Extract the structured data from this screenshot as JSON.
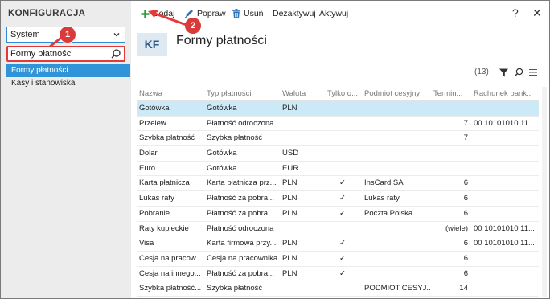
{
  "sidebar": {
    "title": "KONFIGURACJA",
    "select_value": "System",
    "search_value": "Formy płatności",
    "items": [
      {
        "label": "Formy płatności",
        "active": true
      },
      {
        "label": "Kasy i stanowiska",
        "active": false
      }
    ]
  },
  "toolbar": {
    "add": "Dodaj",
    "edit": "Popraw",
    "delete": "Usuń",
    "deactivate": "Dezaktywuj",
    "activate": "Aktywuj",
    "help": "?",
    "close": "✕"
  },
  "header": {
    "tile": "KF",
    "title": "Formy płatności"
  },
  "list_info": {
    "count": "(13)"
  },
  "badges": {
    "first": "1",
    "second": "2"
  },
  "table": {
    "columns": [
      "Nazwa",
      "Typ płatności",
      "Waluta",
      "Tylko o...",
      "Podmiot cesyjny",
      "Termin...",
      "Rachunek bank..."
    ],
    "rows": [
      [
        "Gotówka",
        "Gotówka",
        "PLN",
        "",
        "",
        "",
        ""
      ],
      [
        "Przelew",
        "Płatność odroczona",
        "",
        "",
        "",
        "7",
        "00 10101010 11..."
      ],
      [
        "Szybka płatność",
        "Szybka płatność",
        "",
        "",
        "",
        "7",
        ""
      ],
      [
        "Dolar",
        "Gotówka",
        "USD",
        "",
        "",
        "",
        ""
      ],
      [
        "Euro",
        "Gotówka",
        "EUR",
        "",
        "",
        "",
        ""
      ],
      [
        "Karta płatnicza",
        "Karta płatnicza prz...",
        "PLN",
        "✓",
        "InsCard SA",
        "6",
        ""
      ],
      [
        "Lukas raty",
        "Płatność za pobra...",
        "PLN",
        "✓",
        "Lukas raty",
        "6",
        ""
      ],
      [
        "Pobranie",
        "Płatność za pobra...",
        "PLN",
        "✓",
        "Poczta Polska",
        "6",
        ""
      ],
      [
        "Raty kupieckie",
        "Płatność odroczona",
        "",
        "",
        "",
        "(wiele)",
        "00 10101010 11..."
      ],
      [
        "Visa",
        "Karta firmowa przy...",
        "PLN",
        "✓",
        "",
        "6",
        "00 10101010 11..."
      ],
      [
        "Cesja na pracow...",
        "Cesja na pracownika",
        "PLN",
        "✓",
        "",
        "6",
        ""
      ],
      [
        "Cesja na innego...",
        "Płatność za pobra...",
        "PLN",
        "✓",
        "",
        "6",
        ""
      ],
      [
        "Szybka płatność...",
        "Szybka płatność",
        "",
        "",
        "PODMIOT CESYJ...",
        "14",
        ""
      ]
    ]
  },
  "colors": {
    "accent": "#2f95d8",
    "selected_row": "#cce9f7",
    "badge": "#d93b3b",
    "add_icon": "#2e9b3a",
    "delete_icon": "#2a6fb8"
  }
}
